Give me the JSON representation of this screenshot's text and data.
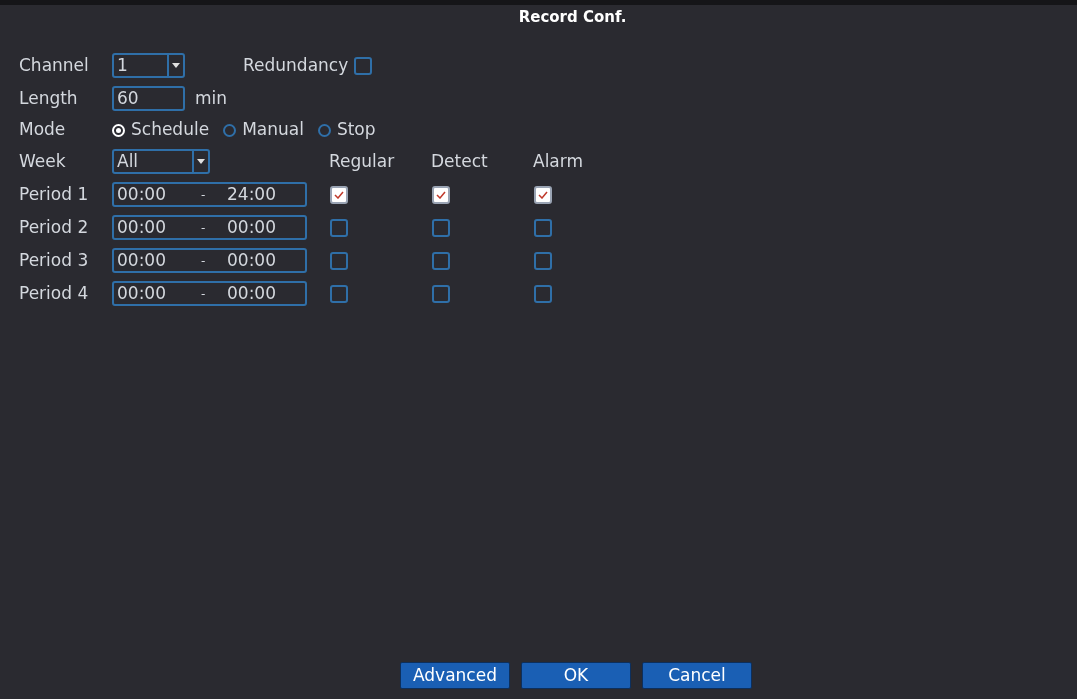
{
  "window": {
    "title": "Record Conf."
  },
  "channel": {
    "label": "Channel",
    "value": "1"
  },
  "redundancy": {
    "label": "Redundancy",
    "checked": false
  },
  "length": {
    "label": "Length",
    "value": "60",
    "unit": "min"
  },
  "mode": {
    "label": "Mode",
    "options": [
      {
        "label": "Schedule",
        "selected": true
      },
      {
        "label": "Manual",
        "selected": false
      },
      {
        "label": "Stop",
        "selected": false
      }
    ]
  },
  "week": {
    "label": "Week",
    "value": "All"
  },
  "columns": [
    "Regular",
    "Detect",
    "Alarm"
  ],
  "periods": [
    {
      "label": "Period 1",
      "start": "00:00",
      "separator": "-",
      "end": "24:00",
      "checks": [
        true,
        true,
        true
      ]
    },
    {
      "label": "Period 2",
      "start": "00:00",
      "separator": "-",
      "end": "00:00",
      "checks": [
        false,
        false,
        false
      ]
    },
    {
      "label": "Period 3",
      "start": "00:00",
      "separator": "-",
      "end": "00:00",
      "checks": [
        false,
        false,
        false
      ]
    },
    {
      "label": "Period 4",
      "start": "00:00",
      "separator": "-",
      "end": "00:00",
      "checks": [
        false,
        false,
        false
      ]
    }
  ],
  "buttons": [
    "Advanced",
    "OK",
    "Cancel"
  ]
}
